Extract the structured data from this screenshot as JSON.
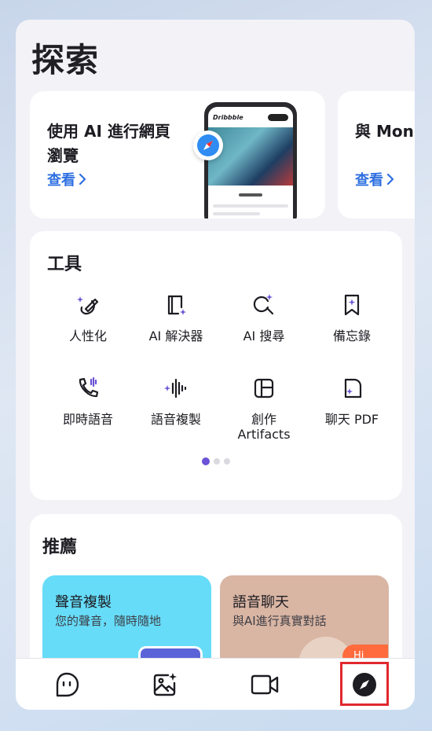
{
  "page": {
    "title": "探索"
  },
  "features": [
    {
      "title": "使用 AI 進行網頁瀏覽",
      "link": "查看",
      "mock_logo": "Dribbble"
    },
    {
      "title": "與 Mon 能地編",
      "link": "查看"
    }
  ],
  "tools": {
    "title": "工具",
    "items": [
      {
        "label": "人性化",
        "icon": "humanize-icon"
      },
      {
        "label": "AI 解決器",
        "icon": "book-sparkle-icon"
      },
      {
        "label": "AI 搜尋",
        "icon": "search-sparkle-icon"
      },
      {
        "label": "備忘錄",
        "icon": "bookmark-star-icon"
      },
      {
        "label": "即時語音",
        "icon": "phone-wave-icon"
      },
      {
        "label": "語音複製",
        "icon": "sound-wave-icon"
      },
      {
        "label": "創作\nArtifacts",
        "icon": "layout-icon"
      },
      {
        "label": "聊天 PDF",
        "icon": "pdf-chat-icon"
      }
    ],
    "page_dots": {
      "count": 3,
      "active": 0
    }
  },
  "recommend": {
    "title": "推薦",
    "cards": [
      {
        "title": "聲音複製",
        "subtitle": "您的聲音，隨時隨地",
        "color": "#66dcf8"
      },
      {
        "title": "語音聊天",
        "subtitle": "與AI進行真實對話",
        "badge": "Hi",
        "color": "#d9b5a3"
      }
    ]
  },
  "nav": {
    "items": [
      "chat-icon",
      "image-sparkle-icon",
      "video-icon",
      "compass-icon"
    ],
    "active": "compass-icon",
    "highlight_color": "#e0282e"
  },
  "colors": {
    "accent": "#6b52d6",
    "link": "#2e6fe0"
  }
}
